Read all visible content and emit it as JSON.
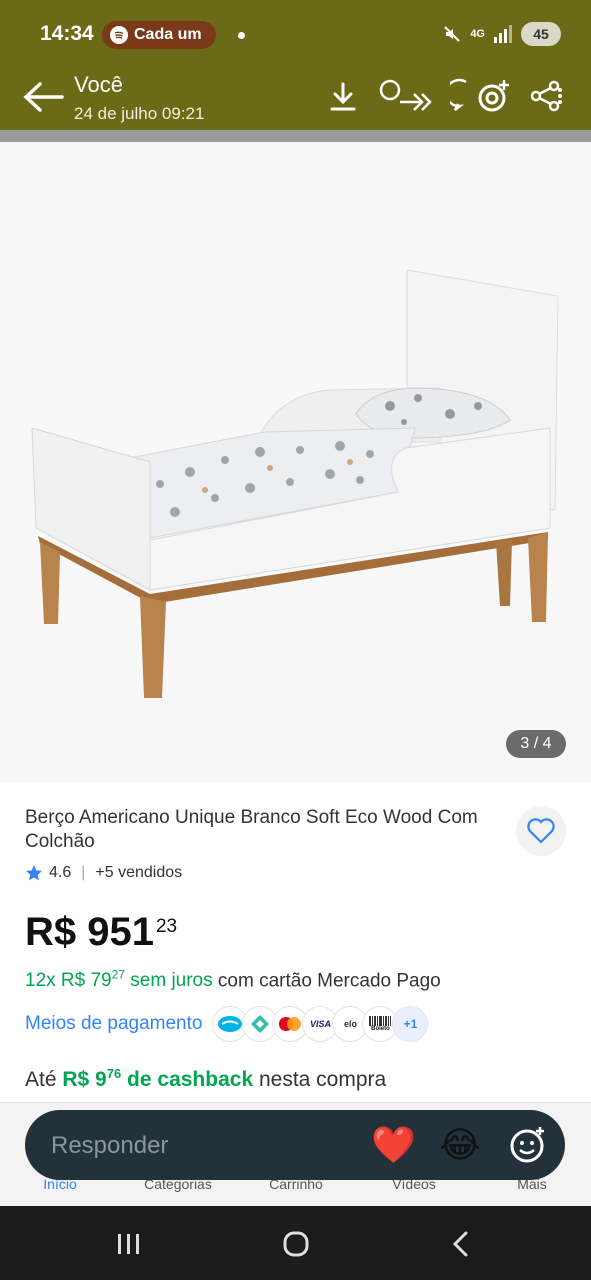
{
  "status_bar": {
    "time": "14:34",
    "spotify_label": "Cada um",
    "network": "4G",
    "battery": "45"
  },
  "header": {
    "contact": "Você",
    "subtitle": "24 de julho 09:21",
    "icons": [
      "back-arrow-icon",
      "download-icon",
      "forward-icon",
      "whatsapp-status-icon",
      "share-icon"
    ]
  },
  "image": {
    "counter": "3 / 4"
  },
  "product": {
    "title": "Berço Americano Unique Branco Soft Eco Wood Com Colchão",
    "rating": "4.6",
    "sold": "+5 vendidos",
    "price_main": "R$ 951",
    "price_cents": "23",
    "installments_prefix": "12x R$ 79",
    "installments_cents": "27",
    "installments_interest": "sem juros",
    "installments_suffix": "com cartão Mercado Pago",
    "payment_link": "Meios de pagamento",
    "payment_logos": [
      "Mercado Pago",
      "Pix",
      "Mastercard",
      "VISA",
      "elo",
      "Boleto"
    ],
    "payment_more": "+1",
    "cashback_prefix": "Até",
    "cashback_value": "R$ 9",
    "cashback_cents": "76",
    "cashback_label": "de cashback",
    "cashback_suffix": "nesta compra"
  },
  "bottom_nav": {
    "items": [
      "Início",
      "Categorias",
      "Carrinho",
      "Vídeos",
      "Mais"
    ]
  },
  "reply": {
    "placeholder": "Responder",
    "heart": "❤️",
    "laugh": "😂"
  },
  "colors": {
    "header_bg": "#6b6a16",
    "accent_blue": "#3483fa",
    "accent_green": "#00a650",
    "reply_bg": "#23323a"
  }
}
